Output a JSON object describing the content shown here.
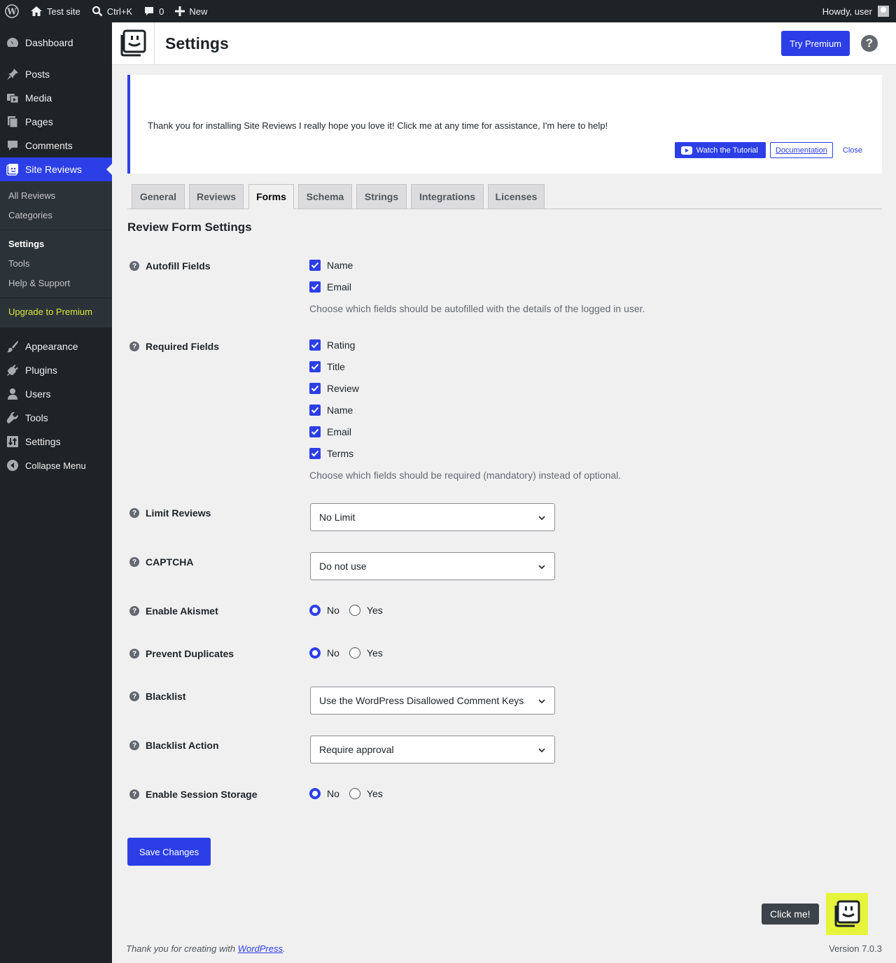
{
  "adminbar": {
    "site": "Test site",
    "search": "Ctrl+K",
    "comments_count": "0",
    "new": "New",
    "howdy": "Howdy, user"
  },
  "sidebar": {
    "dashboard": "Dashboard",
    "posts": "Posts",
    "media": "Media",
    "pages": "Pages",
    "comments": "Comments",
    "site_reviews": "Site Reviews",
    "submenu": [
      "All Reviews",
      "Categories",
      "Settings",
      "Tools",
      "Help & Support",
      "Upgrade to Premium"
    ],
    "appearance": "Appearance",
    "plugins": "Plugins",
    "users": "Users",
    "tools": "Tools",
    "settings": "Settings",
    "collapse": "Collapse Menu"
  },
  "header": {
    "title": "Settings",
    "try_premium": "Try Premium",
    "help": "?"
  },
  "notice": {
    "text": "Thank you for installing Site Reviews I really hope you love it! Click me at any time for assistance, I'm here to help!",
    "watch": "Watch the Tutorial",
    "docs": "Documentation",
    "close": "Close"
  },
  "tabs": [
    "General",
    "Reviews",
    "Forms",
    "Schema",
    "Strings",
    "Integrations",
    "Licenses"
  ],
  "active_tab": "Forms",
  "form": {
    "section_title": "Review Form Settings",
    "autofill": {
      "label": "Autofill Fields",
      "options": [
        "Name",
        "Email"
      ],
      "description": "Choose which fields should be autofilled with the details of the logged in user."
    },
    "required": {
      "label": "Required Fields",
      "options": [
        "Rating",
        "Title",
        "Review",
        "Name",
        "Email",
        "Terms"
      ],
      "description": "Choose which fields should be required (mandatory) instead of optional."
    },
    "limit_reviews": {
      "label": "Limit Reviews",
      "value": "No Limit"
    },
    "captcha": {
      "label": "CAPTCHA",
      "value": "Do not use"
    },
    "akismet": {
      "label": "Enable Akismet",
      "no": "No",
      "yes": "Yes",
      "selected": "No"
    },
    "duplicates": {
      "label": "Prevent Duplicates",
      "no": "No",
      "yes": "Yes",
      "selected": "No"
    },
    "blacklist": {
      "label": "Blacklist",
      "value": "Use the WordPress Disallowed Comment Keys"
    },
    "blacklist_action": {
      "label": "Blacklist Action",
      "value": "Require approval"
    },
    "session_storage": {
      "label": "Enable Session Storage",
      "no": "No",
      "yes": "Yes",
      "selected": "No"
    },
    "save": "Save Changes"
  },
  "assistant": {
    "click_me": "Click me!"
  },
  "footer": {
    "thanks_prefix": "Thank you for creating with ",
    "thanks_link": "WordPress",
    "thanks_suffix": ".",
    "version": "Version 7.0.3"
  },
  "colors": {
    "accent": "#2c3fe6",
    "sidebar": "#1d2327",
    "assistant_bg": "#e6f53c"
  }
}
